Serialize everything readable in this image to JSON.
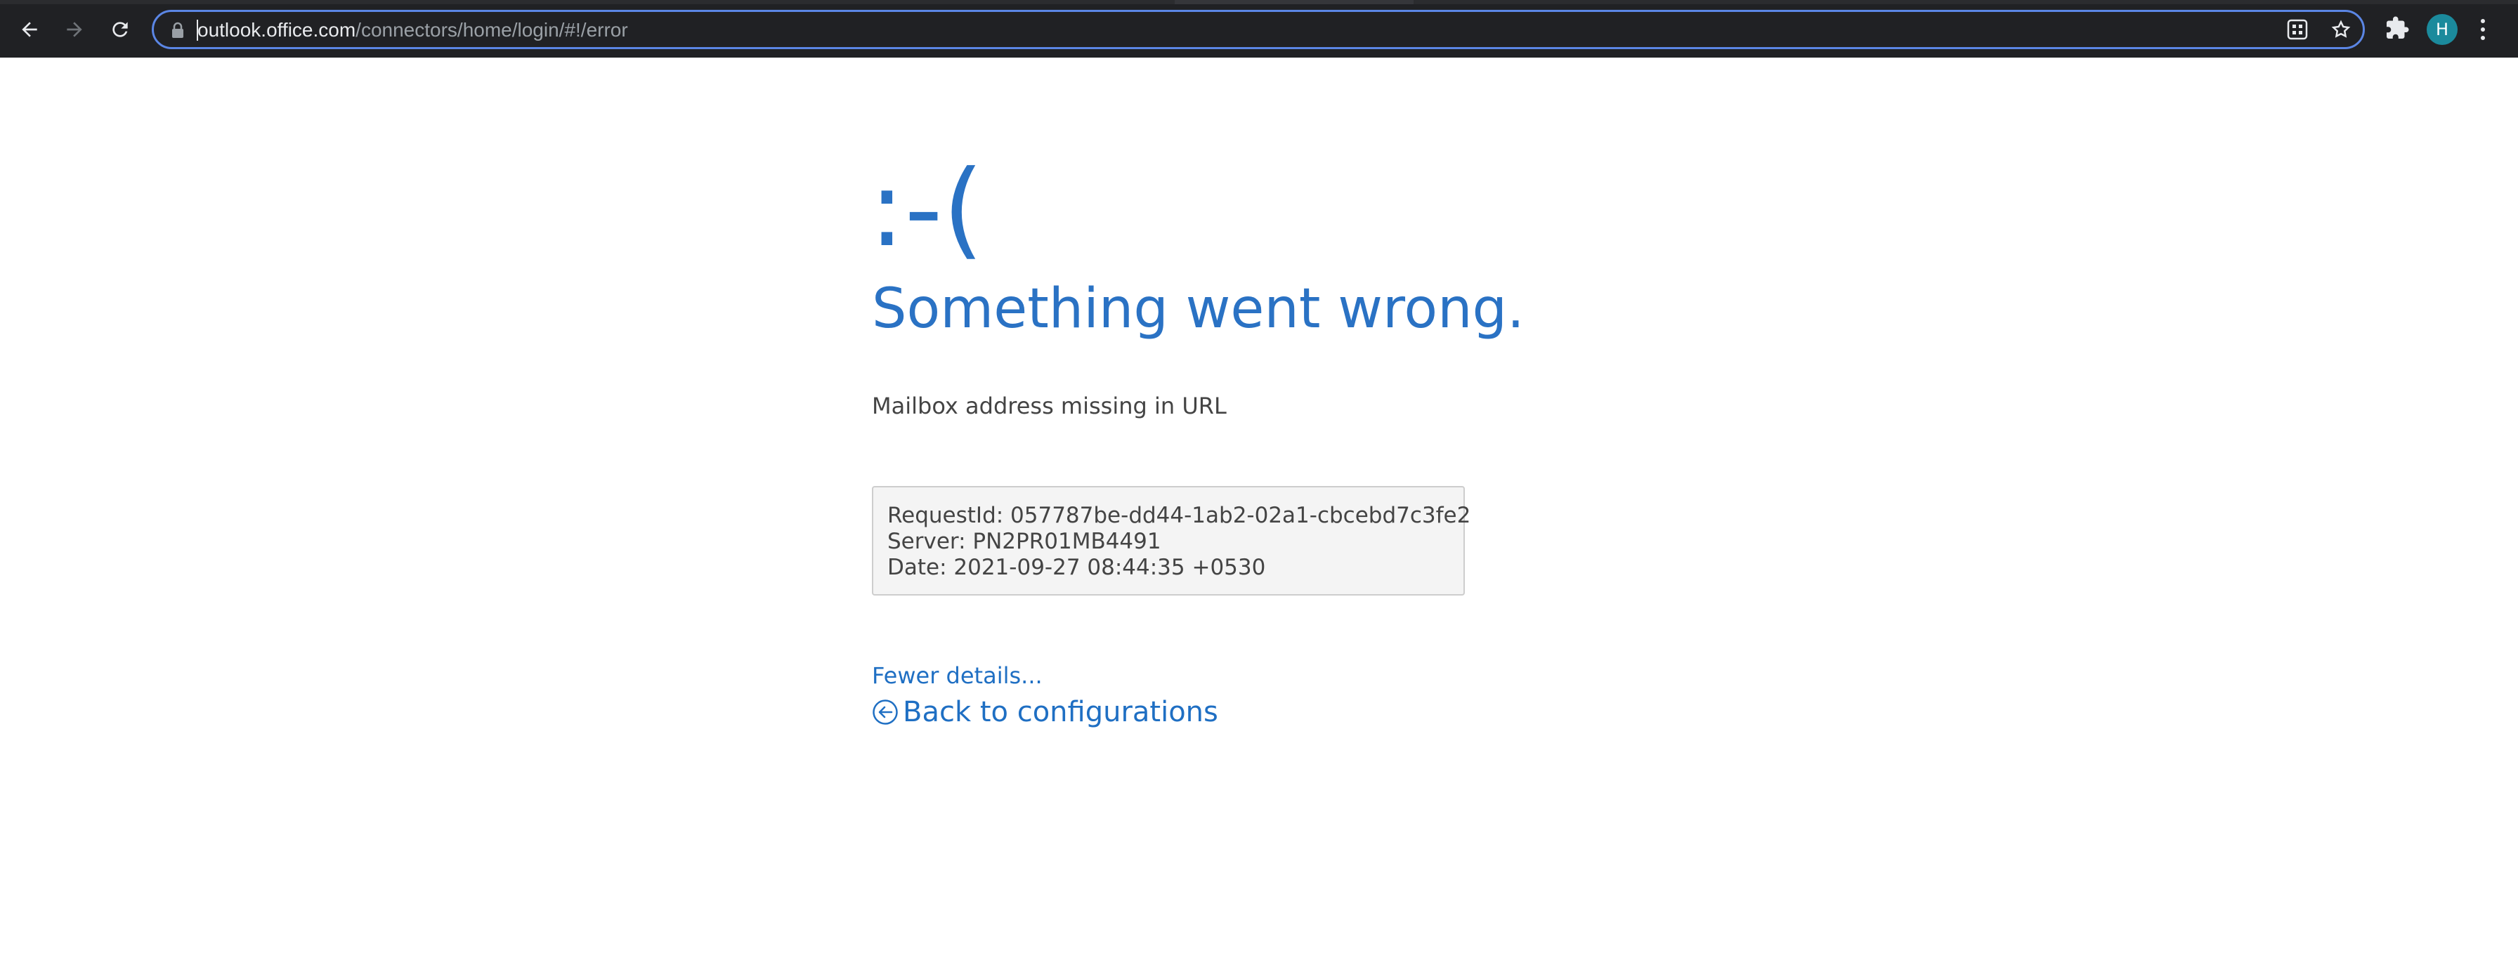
{
  "browser": {
    "url_host": "outlook.office.com",
    "url_path": "/connectors/home/login/#!/error",
    "profile_initial": "H",
    "icons": {
      "back": "arrow-left-icon",
      "forward": "arrow-right-icon",
      "reload": "reload-icon",
      "lock": "lock-icon",
      "qr": "qr-code-icon",
      "bookmark": "star-icon",
      "extensions": "puzzle-icon",
      "menu": "kebab-menu-icon"
    },
    "colors": {
      "toolbar": "#202124",
      "omnibox_focus": "#5b86e5",
      "avatar": "#1b8a9c"
    }
  },
  "error_page": {
    "face": ":-(",
    "title": "Something went wrong.",
    "message": "Mailbox address missing in URL",
    "details": {
      "request_id": "RequestId: 057787be-dd44-1ab2-02a1-cbcebd7c3fe2",
      "server": "Server: PN2PR01MB4491",
      "date": "Date: 2021-09-27 08:44:35 +0530"
    },
    "fewer_details_label": "Fewer details...",
    "back_label": "Back to configurations",
    "back_icon": "circle-arrow-left-icon",
    "colors": {
      "accent": "#2a72c4",
      "link": "#1f6fc3",
      "text": "#444444",
      "details_bg": "#f4f4f4"
    }
  }
}
